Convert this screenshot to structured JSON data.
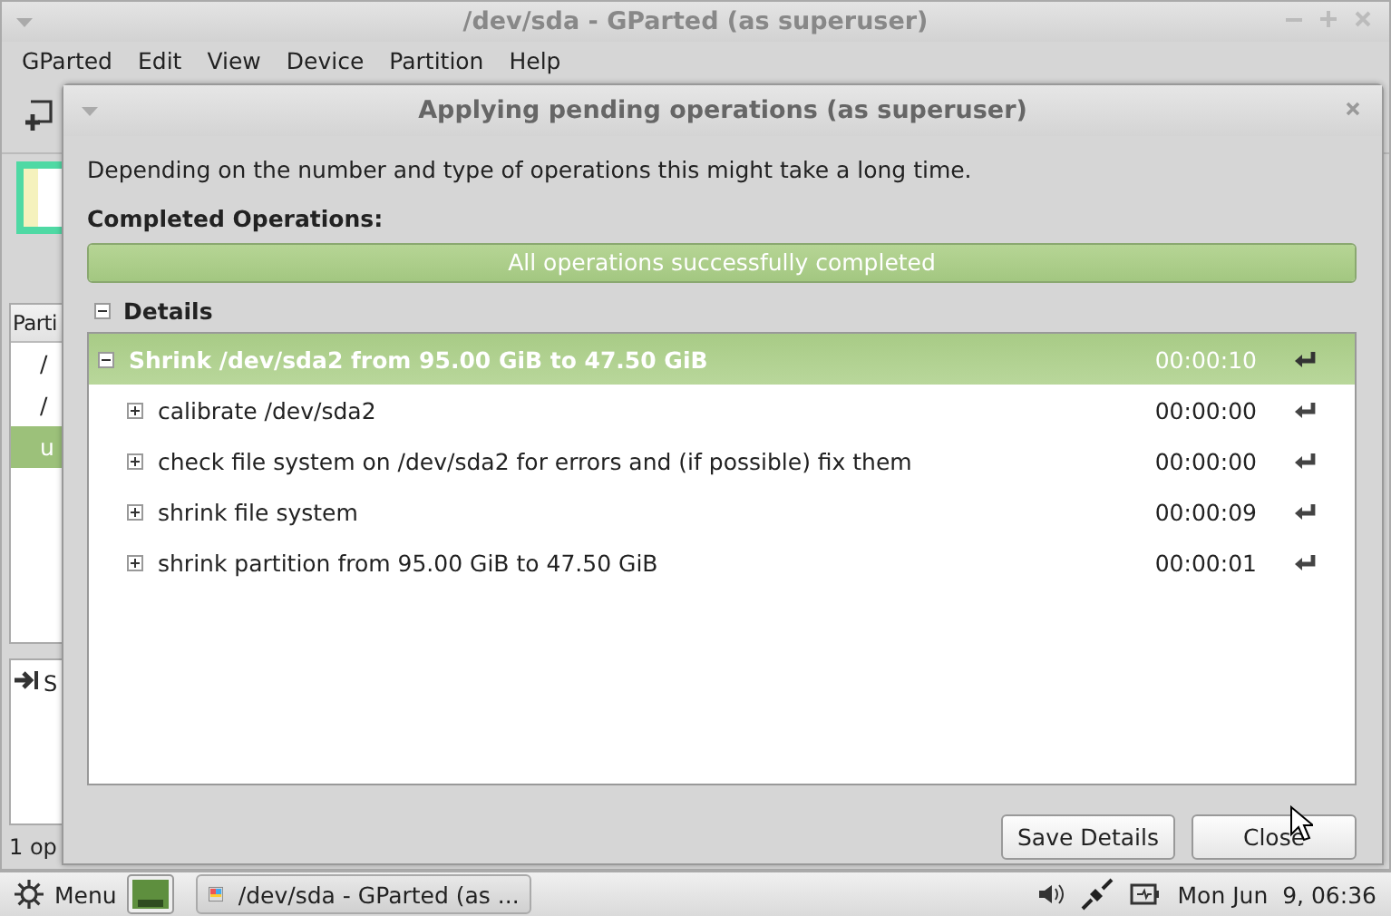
{
  "main_window": {
    "title": "/dev/sda - GParted (as superuser)",
    "menu": [
      "GParted",
      "Edit",
      "View",
      "Device",
      "Partition",
      "Help"
    ],
    "partition_list": {
      "header": "Parti",
      "rows": [
        {
          "text": "/",
          "selected": false
        },
        {
          "text": "/",
          "selected": false
        },
        {
          "text": "u",
          "selected": true
        }
      ]
    },
    "pending_pane": {
      "text": "S"
    },
    "status_bar": "1 op"
  },
  "dialog": {
    "title": "Applying pending operations (as superuser)",
    "message": "Depending on the number and type of operations this might take a long time.",
    "completed_label": "Completed Operations:",
    "progress": {
      "level": 1,
      "text": "All operations successfully completed"
    },
    "details": {
      "label": "Details",
      "expanded": true,
      "operations": [
        {
          "text": "Shrink /dev/sda2 from 95.00 GiB to 47.50 GiB",
          "time": "00:00:10",
          "expanded": true,
          "selected": true,
          "children": [
            {
              "text": "calibrate /dev/sda2",
              "time": "00:00:00",
              "expanded": false,
              "selected": false
            },
            {
              "text": "check file system on /dev/sda2 for errors and (if possible) fix them",
              "time": "00:00:00",
              "expanded": false,
              "selected": false
            },
            {
              "text": "shrink file system",
              "time": "00:00:09",
              "expanded": false,
              "selected": false
            },
            {
              "text": "shrink partition from 95.00 GiB to 47.50 GiB",
              "time": "00:00:01",
              "expanded": false,
              "selected": false
            }
          ]
        }
      ]
    },
    "buttons": [
      {
        "label": "Save Details"
      },
      {
        "label": "Close"
      }
    ]
  },
  "taskbar": {
    "menu_label": "Menu",
    "window_button": "/dev/sda - GParted (as ...",
    "clock": "Mon Jun  9, 06:36"
  }
}
